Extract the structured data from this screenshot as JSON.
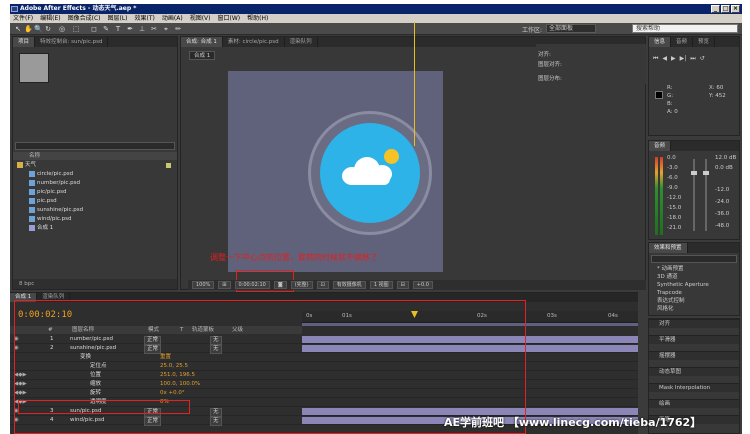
{
  "app": {
    "title": "Adobe After Effects - 动态天气.aep *",
    "win_buttons": [
      "_",
      "□",
      "×"
    ]
  },
  "menu": [
    "文件(F)",
    "编辑(E)",
    "图像合成(C)",
    "图层(L)",
    "效果(T)",
    "动画(A)",
    "视图(V)",
    "窗口(W)",
    "帮助(H)"
  ],
  "toolbar": {
    "tools": [
      "↖",
      "✋",
      "🔍",
      "↻",
      "◎",
      "⬚",
      "◻",
      "✎",
      "T",
      "✒",
      "⊥",
      "✂",
      "⌖",
      "✏"
    ],
    "workspace_label": "工作区:",
    "workspace_value": "全部面板",
    "help_placeholder": "搜索帮助"
  },
  "project_panel": {
    "tabs": [
      "项目",
      "特效控制台: sun/pic.psd"
    ],
    "column_header": "名称",
    "items": [
      {
        "name": "天气",
        "type": "folder"
      },
      {
        "name": "circle/pic.psd",
        "type": "file"
      },
      {
        "name": "number/pic.psd",
        "type": "file"
      },
      {
        "name": "pic/pic.psd",
        "type": "file"
      },
      {
        "name": "pic.psd",
        "type": "file"
      },
      {
        "name": "sunshine/pic.psd",
        "type": "file"
      },
      {
        "name": "wind/pic.psd",
        "type": "file"
      },
      {
        "name": "合成 1",
        "type": "comp"
      }
    ],
    "footer": "8 bpc"
  },
  "composition_panel": {
    "tabs": [
      "合成: 合成 1",
      "素材: circle/pic.psd",
      "渲染队列"
    ],
    "comp_label": "合成 1",
    "annotation": "调整一下中心点的位置，旋转的时候就不偏移了",
    "viewer_bar": [
      "100%",
      "⊞",
      "0:00:02:10",
      "◙",
      "(完整)",
      "⊡",
      "有效摄像机",
      "1 视图",
      "⊟",
      "+0.0"
    ]
  },
  "right_panels": {
    "tabs_top": [
      "信息",
      "音频",
      "预览"
    ],
    "info": {
      "r": "R:",
      "g": "G:",
      "b": "B:",
      "a": "A: 0",
      "x": "X: 60",
      "y": "Y: 452"
    },
    "audio_tab": "音频",
    "audio_levels": [
      "0.0",
      "-3.0",
      "-6.0",
      "-9.0",
      "-12.0",
      "-15.0",
      "-18.0",
      "-21.0",
      "-24.0"
    ],
    "audio_db": [
      "12.0 dB",
      "0.0 dB",
      "-12.0",
      "-24.0",
      "-36.0",
      "-48.0"
    ],
    "effects_tab": "效果和预置",
    "effects": [
      "* 动画预置",
      "3D 通道",
      "Synthetic Aperture",
      "Trapcode",
      "表达式控制",
      "风格化"
    ],
    "sections": [
      "对齐",
      "平滑器",
      "摇摆器",
      "动态草图",
      "Mask Interpolation",
      "绘画",
      "画笔"
    ],
    "align_label": "对齐:",
    "align_layers_label": "图层对齐:",
    "distribute_label": "图层分布:"
  },
  "timeline": {
    "tabs": [
      "合成 1",
      "渲染队列"
    ],
    "time": "0:00:02:10",
    "headers": [
      "#",
      "图层名称",
      "模式",
      "T",
      "轨道蒙板",
      "父级"
    ],
    "rows": [
      {
        "num": "1",
        "name": "number/pic.psd",
        "mode": "正常",
        "parent": "无"
      },
      {
        "num": "2",
        "name": "sunshine/pic.psd",
        "mode": "正常",
        "parent": "无"
      },
      {
        "num": "",
        "name": "变换",
        "mode": "重置",
        "parent": ""
      },
      {
        "num": "",
        "name": "定位点",
        "mode": "25.0, 25.5",
        "parent": ""
      },
      {
        "num": "",
        "name": "位置",
        "mode": "251.0, 196.5",
        "parent": ""
      },
      {
        "num": "",
        "name": "缩放",
        "mode": "100.0, 100.0%",
        "parent": ""
      },
      {
        "num": "",
        "name": "旋转",
        "mode": "0x +0.0°",
        "parent": ""
      },
      {
        "num": "",
        "name": "透明度",
        "mode": "0%",
        "parent": ""
      },
      {
        "num": "3",
        "name": "sun/pic.psd",
        "mode": "正常",
        "parent": "无"
      },
      {
        "num": "4",
        "name": "wind/pic.psd",
        "mode": "正常",
        "parent": "无"
      }
    ],
    "ruler": [
      "0s",
      "01s",
      "02s",
      "03s",
      "04s"
    ]
  },
  "watermark": "AE学前班吧 【www.linecg.com/tieba/1762】"
}
